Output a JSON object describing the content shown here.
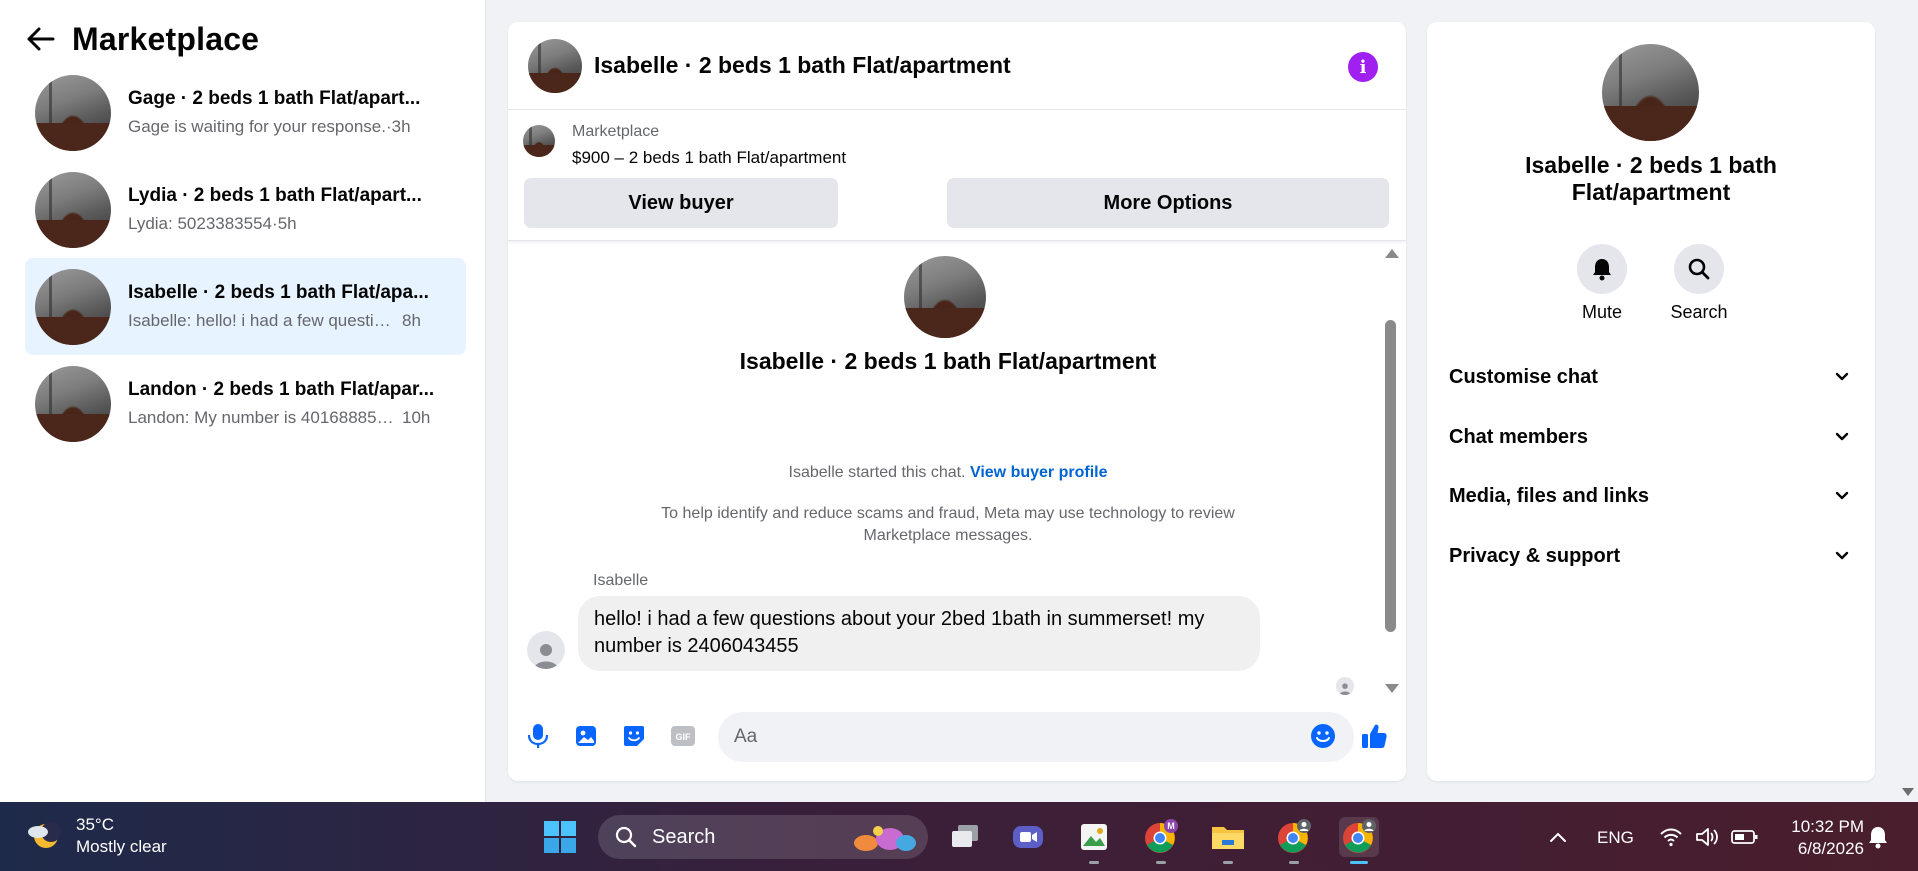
{
  "sidebar": {
    "title": "Marketplace",
    "conversations": [
      {
        "name": "Gage · 2 beds 1 bath Flat/apart...",
        "preview": "Gage is waiting for your response.",
        "sep": "·",
        "time": "3h",
        "active": false
      },
      {
        "name": "Lydia · 2 beds 1 bath Flat/apart...",
        "preview": "Lydia: 5023383554",
        "sep": "·",
        "time": "5h",
        "active": false
      },
      {
        "name": "Isabelle · 2 beds 1 bath Flat/apa...",
        "preview": "Isabelle: hello! i had a few question...",
        "sep": "",
        "time": "8h",
        "active": true
      },
      {
        "name": "Landon · 2 beds 1 bath Flat/apar...",
        "preview": "Landon: My number is 401688856...",
        "sep": "",
        "time": "10h",
        "active": false
      }
    ]
  },
  "chat": {
    "title": "Isabelle · 2 beds 1 bath Flat/apartment",
    "marketplace_label": "Marketplace",
    "listing": "$900 – 2 beds 1 bath Flat/apartment",
    "view_buyer": "View buyer",
    "more_options": "More Options",
    "center_title": "Isabelle · 2 beds 1 bath Flat/apartment",
    "started_text": "Isabelle started this chat.",
    "started_link": "View buyer profile",
    "notice": "To help identify and reduce scams and fraud, Meta may use technology to review Marketplace messages.",
    "sender": "Isabelle",
    "message": "hello! i had a few questions about your 2bed 1bath in summerset! my number is 2406043455",
    "input_placeholder": "Aa",
    "gif_label": "GIF"
  },
  "info": {
    "title": "Isabelle · 2 beds 1 bath Flat/apartment",
    "mute": "Mute",
    "search": "Search",
    "sections": [
      "Customise chat",
      "Chat members",
      "Media, files and links",
      "Privacy & support"
    ]
  },
  "taskbar": {
    "temp": "35°C",
    "condition": "Mostly clear",
    "search": "Search",
    "language": "ENG",
    "time": "10:32 PM",
    "date": "6/8/2026",
    "badge_letter": "M"
  },
  "colors": {
    "accent": "#0866ff",
    "info_purple": "#a020f0",
    "active_row": "#e7f3ff"
  }
}
